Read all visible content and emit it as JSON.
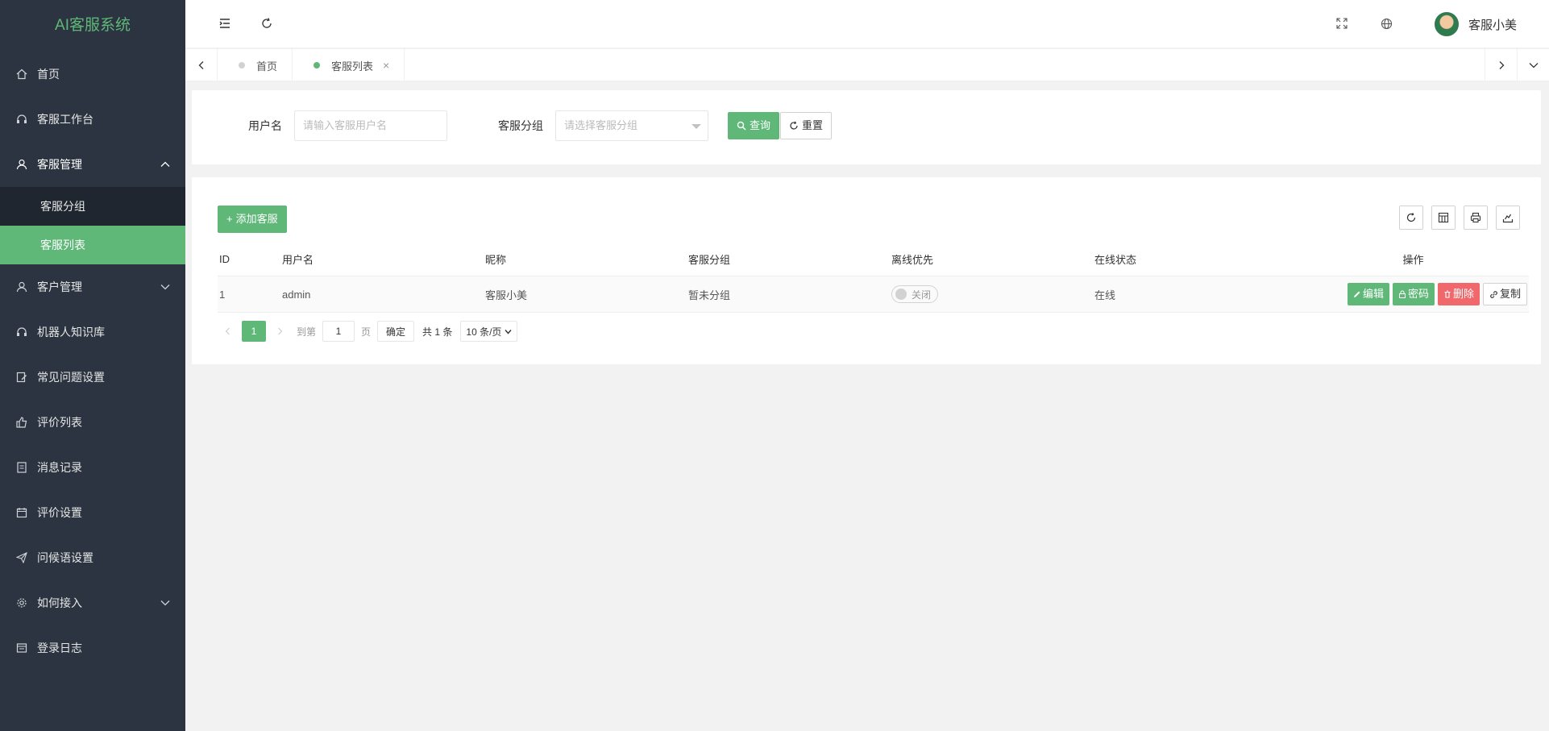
{
  "app": {
    "title": "AI客服系统"
  },
  "colors": {
    "accent": "#5fb878",
    "sidebar": "#2b3440",
    "danger": "#f0686b"
  },
  "sidebar": {
    "items": [
      {
        "label": "首页",
        "icon": "home-icon"
      },
      {
        "label": "客服工作台",
        "icon": "headset-icon"
      },
      {
        "label": "客服管理",
        "icon": "user-icon",
        "expanded": true,
        "children": [
          {
            "label": "客服分组"
          },
          {
            "label": "客服列表",
            "active": true
          }
        ]
      },
      {
        "label": "客户管理",
        "icon": "user-icon",
        "expandable": true
      },
      {
        "label": "机器人知识库",
        "icon": "headset-icon"
      },
      {
        "label": "常见问题设置",
        "icon": "edit-icon"
      },
      {
        "label": "评价列表",
        "icon": "thumb-up-icon"
      },
      {
        "label": "消息记录",
        "icon": "file-icon"
      },
      {
        "label": "评价设置",
        "icon": "calendar-icon"
      },
      {
        "label": "问候语设置",
        "icon": "send-icon"
      },
      {
        "label": "如何接入",
        "icon": "gear-icon",
        "expandable": true
      },
      {
        "label": "登录日志",
        "icon": "log-icon"
      }
    ]
  },
  "header": {
    "user_name": "客服小美"
  },
  "tabs": [
    {
      "label": "首页",
      "active": false
    },
    {
      "label": "客服列表",
      "active": true
    }
  ],
  "search": {
    "username_label": "用户名",
    "username_placeholder": "请输入客服用户名",
    "group_label": "客服分组",
    "group_placeholder": "请选择客服分组",
    "query_label": "查询",
    "reset_label": "重置"
  },
  "table": {
    "add_label": "添加客服",
    "columns": [
      "ID",
      "用户名",
      "昵称",
      "客服分组",
      "离线优先",
      "在线状态",
      "操作"
    ],
    "rows": [
      {
        "id": "1",
        "username": "admin",
        "nickname": "客服小美",
        "group": "暂未分组",
        "offline_first": "关闭",
        "status": "在线"
      }
    ],
    "actions": {
      "edit": "编辑",
      "password": "密码",
      "delete": "删除",
      "copy": "复制"
    }
  },
  "pager": {
    "current": "1",
    "goto_label": "到第",
    "page_value": "1",
    "page_unit": "页",
    "confirm": "确定",
    "total": "共 1 条",
    "page_size": "10 条/页"
  }
}
